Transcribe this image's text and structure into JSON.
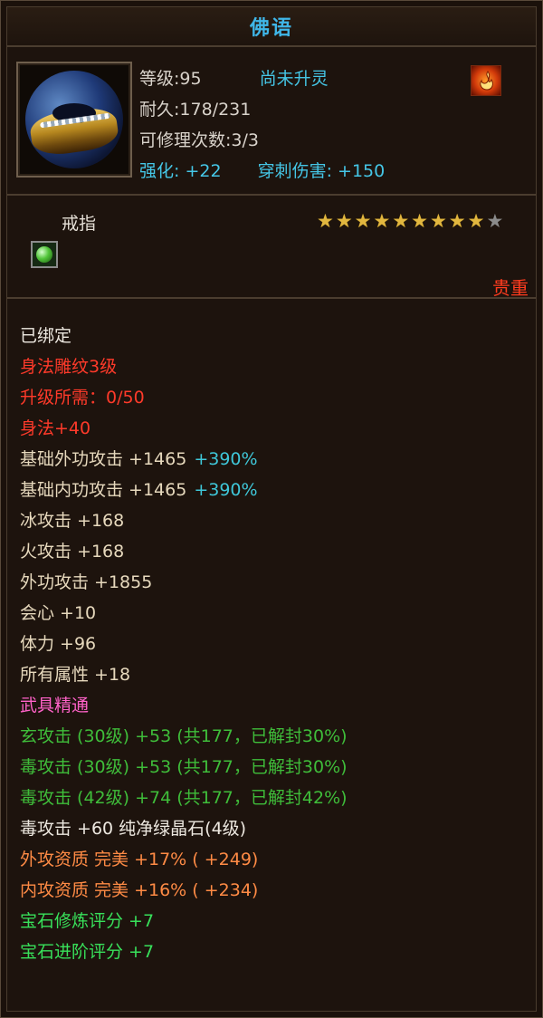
{
  "title": "佛语",
  "header": {
    "level": "等级:95",
    "soul_status": "尚未升灵",
    "durability": "耐久:178/231",
    "repair_count": "可修理次数:3/3",
    "enhance": "强化: +22",
    "pierce": "穿刺伤害: +150"
  },
  "item": {
    "type": "戒指",
    "stars_filled": 9,
    "stars_total": 10,
    "rarity": "贵重"
  },
  "icons": {
    "item_icon": "gold-ring-icon",
    "soul_badge": "flame-badge-icon",
    "gem_slot": "green-gem-icon"
  },
  "attributes": [
    {
      "text": "已绑定",
      "color": "#ede8e0"
    },
    {
      "text": "身法雕纹3级",
      "color": "#ff3a2a"
    },
    {
      "text": "升级所需：0/50",
      "color": "#ff3a2a"
    },
    {
      "text": "身法+40",
      "color": "#ff3a2a"
    },
    {
      "text": "基础外功攻击 +1465",
      "extra": "+390%",
      "color": "#e7d9bd"
    },
    {
      "text": "基础内功攻击 +1465",
      "extra": "+390%",
      "color": "#e7d9bd"
    },
    {
      "text": "冰攻击 +168",
      "color": "#e7d9bd"
    },
    {
      "text": "火攻击 +168",
      "color": "#e7d9bd"
    },
    {
      "text": "外功攻击 +1855",
      "color": "#e7d9bd"
    },
    {
      "text": "会心 +10",
      "color": "#e7d9bd"
    },
    {
      "text": "体力 +96",
      "color": "#e7d9bd"
    },
    {
      "text": "所有属性 +18",
      "color": "#e7d9bd"
    },
    {
      "text": "武具精通",
      "color": "#ff62c8"
    },
    {
      "text": "玄攻击 (30级) +53 (共177，已解封30%)",
      "color": "#3fbd3a"
    },
    {
      "text": "毒攻击 (30级) +53 (共177，已解封30%)",
      "color": "#3fbd3a"
    },
    {
      "text": "毒攻击 (42级) +74 (共177，已解封42%)",
      "color": "#3fbd3a"
    },
    {
      "text": "毒攻击 +60 纯净绿晶石(4级)",
      "color": "#ede8e0"
    },
    {
      "text": "外攻资质  完美 +17% ( +249)",
      "color": "#ff8b45"
    },
    {
      "text": "内攻资质  完美 +16% ( +234)",
      "color": "#ff8b45"
    },
    {
      "text": "宝石修炼评分 +7",
      "color": "#38e05a"
    },
    {
      "text": "宝石进阶评分 +7",
      "color": "#38e05a"
    }
  ]
}
